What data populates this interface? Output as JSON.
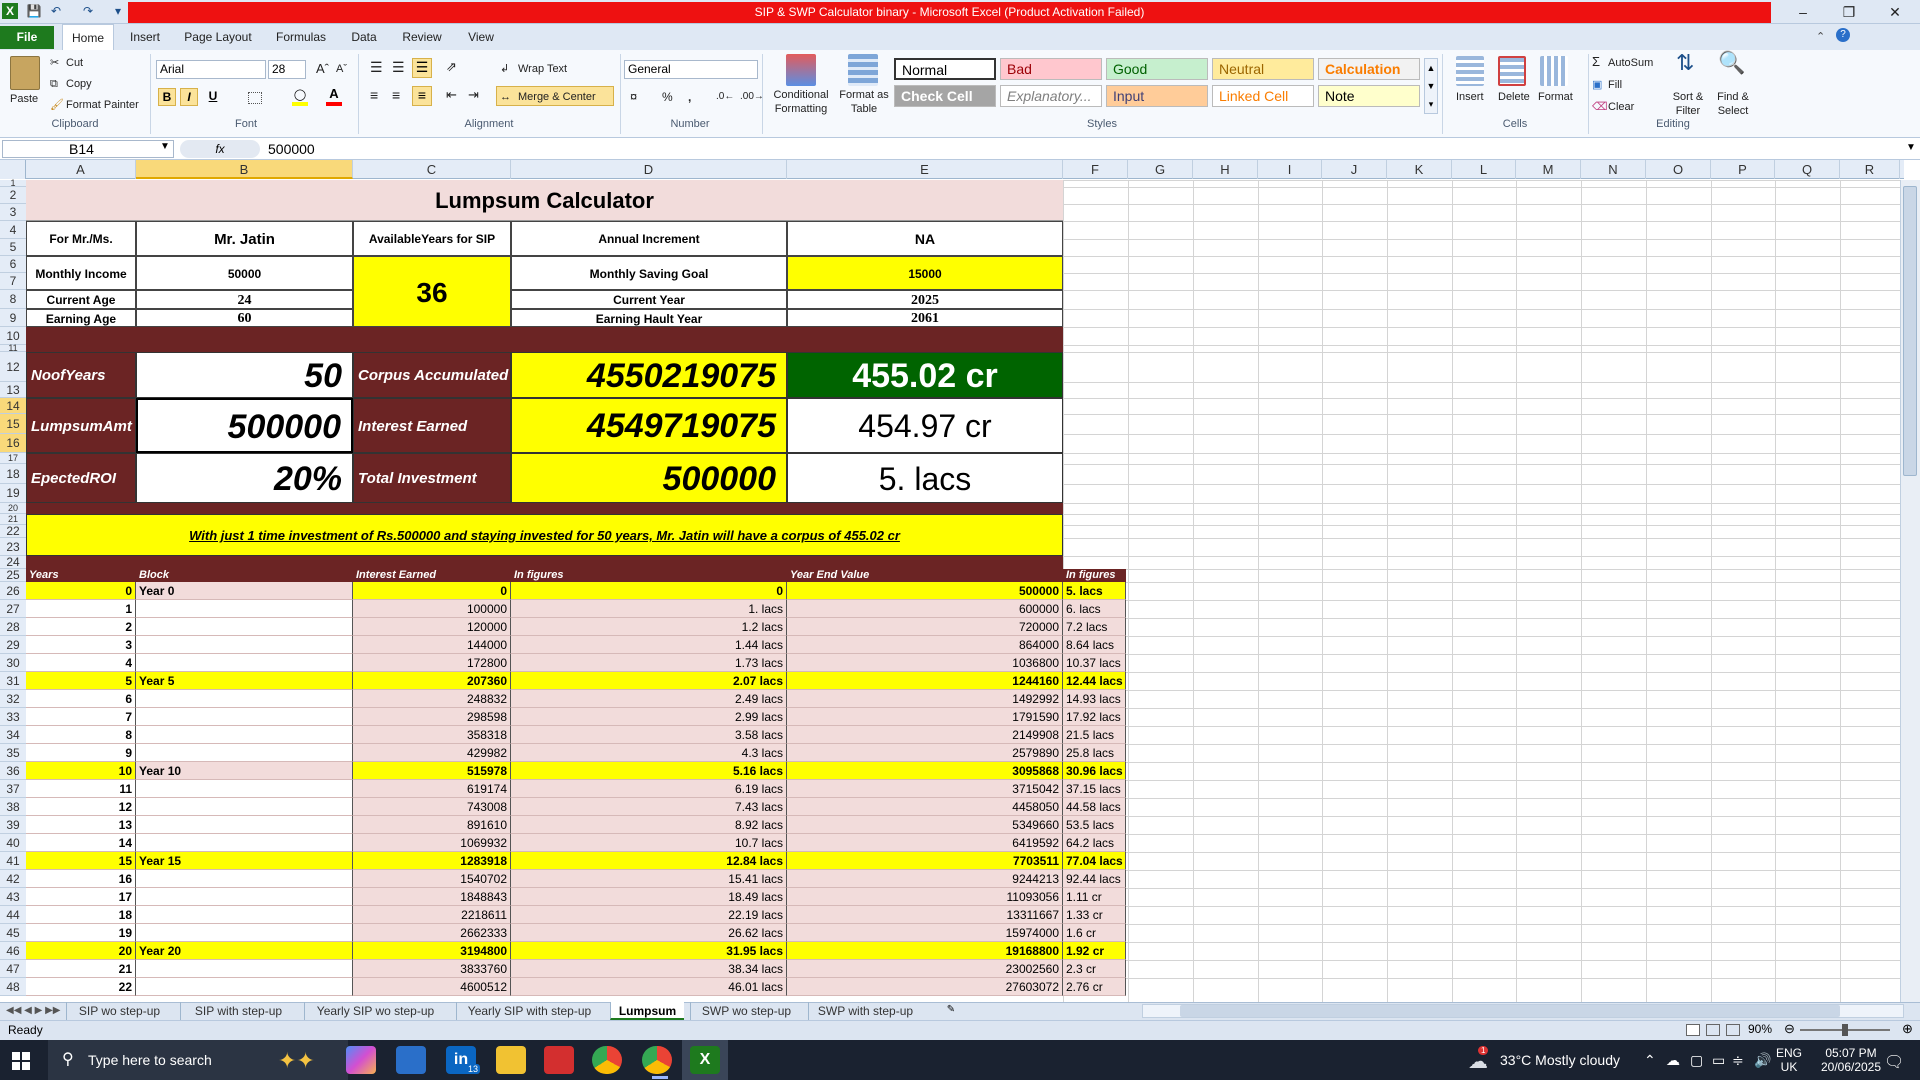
{
  "window": {
    "title": "SIP & SWP Calculator binary - Microsoft Excel (Product Activation Failed)"
  },
  "tabs": [
    "File",
    "Home",
    "Insert",
    "Page Layout",
    "Formulas",
    "Data",
    "Review",
    "View"
  ],
  "ribbon": {
    "clipboard": {
      "paste": "Paste",
      "cut": "Cut",
      "copy": "Copy",
      "format_painter": "Format Painter",
      "label": "Clipboard"
    },
    "font": {
      "name": "Arial",
      "size": "28",
      "label": "Font"
    },
    "alignment": {
      "wrap": "Wrap Text",
      "merge": "Merge & Center",
      "label": "Alignment"
    },
    "number": {
      "format": "General",
      "label": "Number"
    },
    "styles": {
      "conditional": "Conditional Formatting",
      "format_table": "Format as Table",
      "label": "Styles",
      "cells": [
        {
          "text": "Normal",
          "bg": "#ffffff",
          "fg": "#000000"
        },
        {
          "text": "Bad",
          "bg": "#ffc7ce",
          "fg": "#9c0006"
        },
        {
          "text": "Good",
          "bg": "#c6efce",
          "fg": "#006100"
        },
        {
          "text": "Neutral",
          "bg": "#ffeb9c",
          "fg": "#9c6500"
        },
        {
          "text": "Calculation",
          "bg": "#f2f2f2",
          "fg": "#fa7d00"
        },
        {
          "text": "Check Cell",
          "bg": "#a5a5a5",
          "fg": "#ffffff"
        },
        {
          "text": "Explanatory...",
          "bg": "#ffffff",
          "fg": "#7f7f7f"
        },
        {
          "text": "Input",
          "bg": "#ffcc99",
          "fg": "#3f3f76"
        },
        {
          "text": "Linked Cell",
          "bg": "#ffffff",
          "fg": "#fa7d00"
        },
        {
          "text": "Note",
          "bg": "#ffffcc",
          "fg": "#000000"
        }
      ]
    },
    "cells": {
      "insert": "Insert",
      "delete": "Delete",
      "format": "Format",
      "label": "Cells"
    },
    "editing": {
      "autosum": "AutoSum",
      "fill": "Fill",
      "clear": "Clear",
      "sort": "Sort & Filter",
      "find": "Find & Select",
      "label": "Editing"
    }
  },
  "formula_bar": {
    "name_box": "B14",
    "fx": "fx",
    "value": "500000"
  },
  "columns": [
    "A",
    "B",
    "C",
    "D",
    "E",
    "F",
    "G",
    "H",
    "I",
    "J",
    "K",
    "L",
    "M",
    "N",
    "O",
    "P",
    "Q",
    "R"
  ],
  "sheet": {
    "title": "Lumpsum Calculator",
    "for_label": "For Mr./Ms.",
    "name": "Mr. Jatin",
    "avail_label": "AvailableYears for SIP",
    "avail_value": "36",
    "annual_label": "Annual Increment",
    "annual_value": "NA",
    "income_label": "Monthly Income",
    "income_value": "50000",
    "goal_label": "Monthly Saving Goal",
    "goal_value": "15000",
    "age_label": "Current Age",
    "age_value": "24",
    "curyear_label": "Current Year",
    "curyear_value": "2025",
    "earnage_label": "Earning Age",
    "earnage_value": "60",
    "hault_label": "Earning Hault Year",
    "hault_value": "2061",
    "years_label": "NoofYears",
    "years_value": "50",
    "corpus_label": "Corpus Accumulated",
    "corpus_value": "4550219075",
    "corpus_cr": "455.02 cr",
    "lump_label": "LumpsumAmt",
    "lump_value": "500000",
    "interest_label": "Interest Earned",
    "interest_value": "4549719075",
    "interest_cr": "454.97 cr",
    "roi_label": "EpectedROI",
    "roi_value": "20%",
    "invest_label": "Total Investment",
    "invest_value": "500000",
    "invest_lacs": "5. lacs",
    "banner": "With just 1 time investment of Rs.500000 and staying invested for 50 years, Mr. Jatin will have a corpus of 455.02 cr",
    "table_headers": [
      "Years",
      "Block",
      "Interest Earned",
      "In figures",
      "Year End Value",
      "In figures"
    ],
    "rows": [
      {
        "y": "0",
        "block": "Year 0",
        "ie": "0",
        "iefig": "0",
        "yev": "500000",
        "yevfig": "5. lacs",
        "hl": true
      },
      {
        "y": "1",
        "block": "",
        "ie": "100000",
        "iefig": "1. lacs",
        "yev": "600000",
        "yevfig": "6. lacs",
        "hl": false
      },
      {
        "y": "2",
        "block": "",
        "ie": "120000",
        "iefig": "1.2 lacs",
        "yev": "720000",
        "yevfig": "7.2 lacs",
        "hl": false
      },
      {
        "y": "3",
        "block": "",
        "ie": "144000",
        "iefig": "1.44 lacs",
        "yev": "864000",
        "yevfig": "8.64 lacs",
        "hl": false
      },
      {
        "y": "4",
        "block": "",
        "ie": "172800",
        "iefig": "1.73 lacs",
        "yev": "1036800",
        "yevfig": "10.37 lacs",
        "hl": false
      },
      {
        "y": "5",
        "block": "Year 5",
        "ie": "207360",
        "iefig": "2.07 lacs",
        "yev": "1244160",
        "yevfig": "12.44 lacs",
        "hl": true
      },
      {
        "y": "6",
        "block": "",
        "ie": "248832",
        "iefig": "2.49 lacs",
        "yev": "1492992",
        "yevfig": "14.93 lacs",
        "hl": false
      },
      {
        "y": "7",
        "block": "",
        "ie": "298598",
        "iefig": "2.99 lacs",
        "yev": "1791590",
        "yevfig": "17.92 lacs",
        "hl": false
      },
      {
        "y": "8",
        "block": "",
        "ie": "358318",
        "iefig": "3.58 lacs",
        "yev": "2149908",
        "yevfig": "21.5 lacs",
        "hl": false
      },
      {
        "y": "9",
        "block": "",
        "ie": "429982",
        "iefig": "4.3 lacs",
        "yev": "2579890",
        "yevfig": "25.8 lacs",
        "hl": false
      },
      {
        "y": "10",
        "block": "Year 10",
        "ie": "515978",
        "iefig": "5.16 lacs",
        "yev": "3095868",
        "yevfig": "30.96 lacs",
        "hl": true
      },
      {
        "y": "11",
        "block": "",
        "ie": "619174",
        "iefig": "6.19 lacs",
        "yev": "3715042",
        "yevfig": "37.15 lacs",
        "hl": false
      },
      {
        "y": "12",
        "block": "",
        "ie": "743008",
        "iefig": "7.43 lacs",
        "yev": "4458050",
        "yevfig": "44.58 lacs",
        "hl": false
      },
      {
        "y": "13",
        "block": "",
        "ie": "891610",
        "iefig": "8.92 lacs",
        "yev": "5349660",
        "yevfig": "53.5 lacs",
        "hl": false
      },
      {
        "y": "14",
        "block": "",
        "ie": "1069932",
        "iefig": "10.7 lacs",
        "yev": "6419592",
        "yevfig": "64.2 lacs",
        "hl": false
      },
      {
        "y": "15",
        "block": "Year 15",
        "ie": "1283918",
        "iefig": "12.84 lacs",
        "yev": "7703511",
        "yevfig": "77.04 lacs",
        "hl": true
      },
      {
        "y": "16",
        "block": "",
        "ie": "1540702",
        "iefig": "15.41 lacs",
        "yev": "9244213",
        "yevfig": "92.44 lacs",
        "hl": false
      },
      {
        "y": "17",
        "block": "",
        "ie": "1848843",
        "iefig": "18.49 lacs",
        "yev": "11093056",
        "yevfig": "1.11 cr",
        "hl": false
      },
      {
        "y": "18",
        "block": "",
        "ie": "2218611",
        "iefig": "22.19 lacs",
        "yev": "13311667",
        "yevfig": "1.33 cr",
        "hl": false
      },
      {
        "y": "19",
        "block": "",
        "ie": "2662333",
        "iefig": "26.62 lacs",
        "yev": "15974000",
        "yevfig": "1.6 cr",
        "hl": false
      },
      {
        "y": "20",
        "block": "Year 20",
        "ie": "3194800",
        "iefig": "31.95 lacs",
        "yev": "19168800",
        "yevfig": "1.92 cr",
        "hl": true
      },
      {
        "y": "21",
        "block": "",
        "ie": "3833760",
        "iefig": "38.34 lacs",
        "yev": "23002560",
        "yevfig": "2.3 cr",
        "hl": false
      },
      {
        "y": "22",
        "block": "",
        "ie": "4600512",
        "iefig": "46.01 lacs",
        "yev": "27603072",
        "yevfig": "2.76 cr",
        "hl": false
      }
    ]
  },
  "sheet_tabs": [
    "SIP wo step-up",
    "SIP with step-up",
    "Yearly SIP wo step-up",
    "Yearly SIP with step-up",
    "Lumpsum",
    "SWP wo step-up",
    "SWP with step-up"
  ],
  "status": {
    "ready": "Ready",
    "zoom": "90%"
  },
  "taskbar": {
    "search": "Type here to search",
    "weather": "33°C  Mostly cloudy",
    "lang1": "ENG",
    "lang2": "UK",
    "time": "05:07 PM",
    "date": "20/06/2025",
    "linkedin_badge": "13",
    "weather_badge": "1"
  }
}
